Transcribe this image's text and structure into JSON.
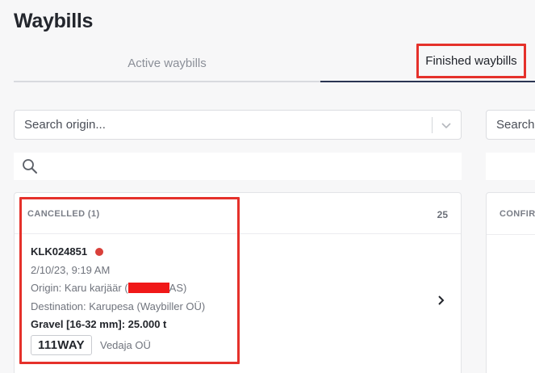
{
  "page": {
    "title": "Waybills"
  },
  "tabs": {
    "active_label": "Active waybills",
    "finished_label": "Finished waybills"
  },
  "filters": {
    "origin_placeholder": "Search origin...",
    "origin_placeholder_right": "Search",
    "search_placeholder": ""
  },
  "cancelled_panel": {
    "label": "CANCELLED (1)",
    "count": "25",
    "card": {
      "number": "KLK024851",
      "date": "2/10/23, 9:19 AM",
      "origin_prefix": "Origin: Karu karjäär (",
      "origin_suffix": "AS)",
      "destination": "Destination: Karupesa (Waybiller OÜ)",
      "cargo": "Gravel [16-32 mm]: 25.000 t",
      "plate": "111WAY",
      "carrier": "Vedaja OÜ"
    }
  },
  "confirmed_panel": {
    "label": "CONFIRMED"
  },
  "colors": {
    "highlight": "#e5312b",
    "status_dot": "#d9403a",
    "redaction": "#f01818",
    "tab_underline": "#2a3553"
  }
}
